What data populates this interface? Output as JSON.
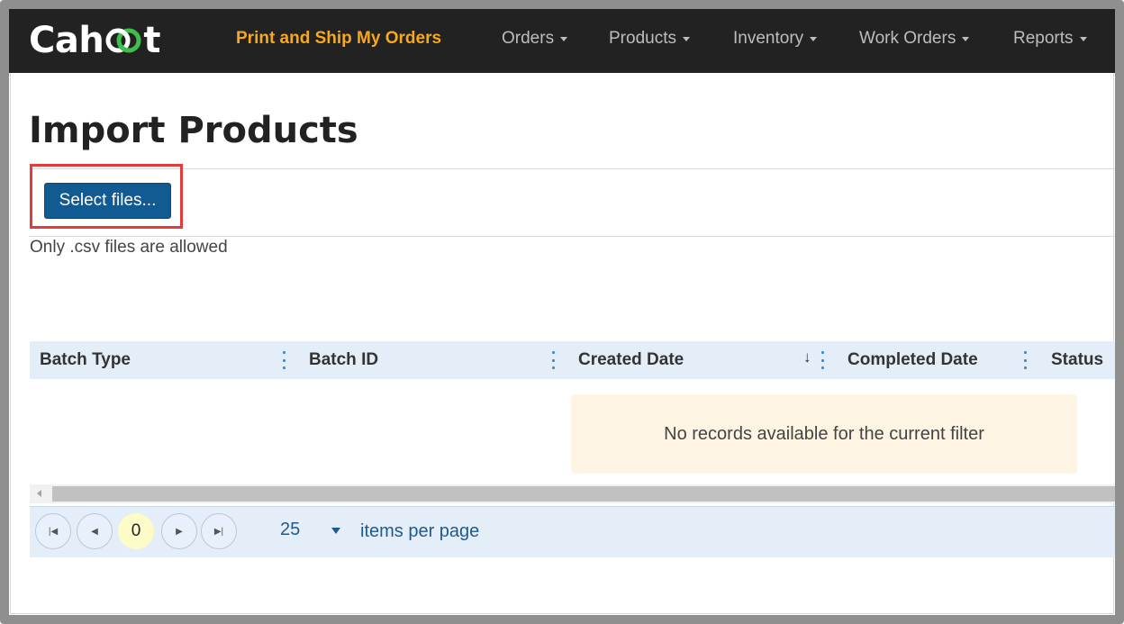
{
  "navbar": {
    "brand": "Cahoot",
    "brand_prefix": "Cah",
    "brand_suffix": "t",
    "primary_link": "Print and Ship My Orders",
    "menus": [
      "Orders",
      "Products",
      "Inventory",
      "Work Orders",
      "Reports"
    ],
    "colors": {
      "background": "#222222",
      "highlight": "#f7a81b",
      "menu_text": "#bdbdbd",
      "logo_accent": "#3dbf4c"
    }
  },
  "page": {
    "title": "Import Products",
    "upload_button": "Select files...",
    "upload_hint": "Only .csv files are allowed",
    "highlight_color": "#e53b3b",
    "button_color": "#125a92"
  },
  "grid": {
    "columns": [
      "Batch Type",
      "Batch ID",
      "Created Date",
      "Completed Date",
      "Status"
    ],
    "sort_indicator": "↓",
    "sorted_column": "Created Date",
    "no_records": "No records available for the current filter",
    "pager": {
      "current_page": "0",
      "page_size": "25",
      "page_size_label": "items per page"
    }
  }
}
